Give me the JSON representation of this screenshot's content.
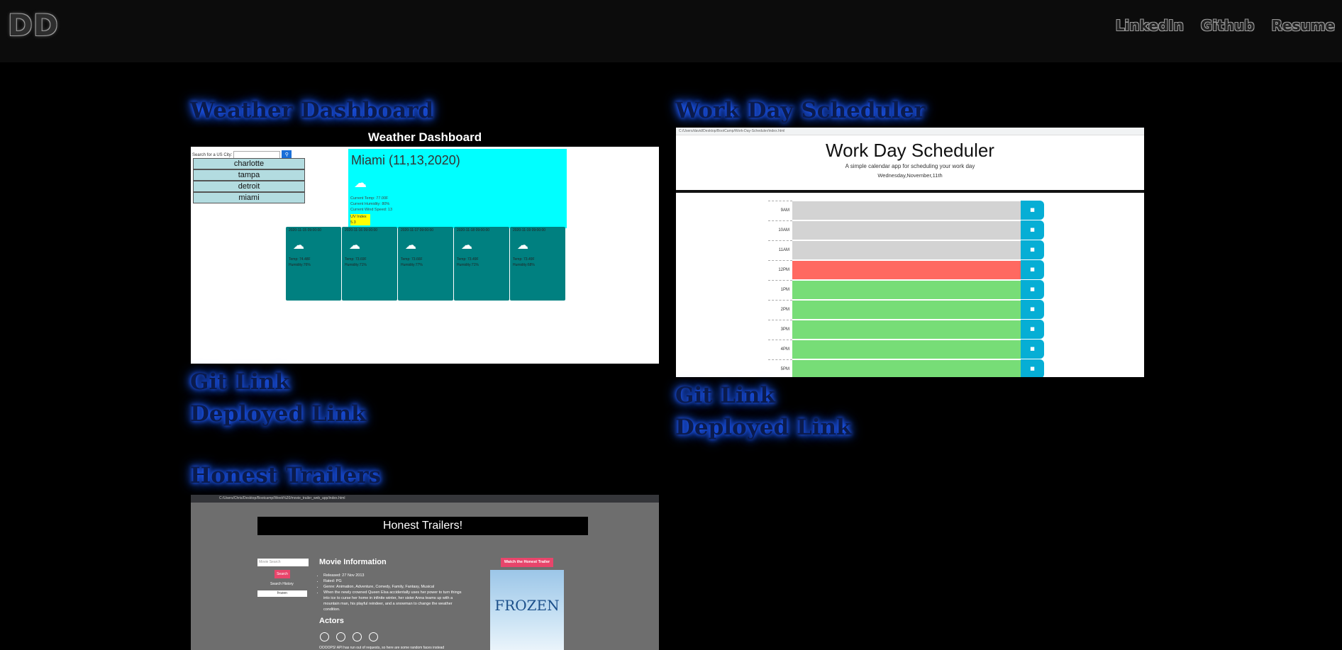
{
  "header": {
    "logo": "DD",
    "nav": [
      "LinkedIn",
      "Github",
      "Resume"
    ]
  },
  "projects": [
    {
      "title": "Weather Dashboard",
      "git": "Git Link",
      "deployed": "Deployed Link"
    },
    {
      "title": "Work Day Scheduler",
      "git": "Git Link",
      "deployed": "Deployed Link"
    },
    {
      "title": "Honest Trailers"
    }
  ],
  "weather_shot": {
    "heading": "Weather Dashboard",
    "search_label": "Search for a US City:",
    "search_icon": "search-icon",
    "cities": [
      "charlotte",
      "tampa",
      "detroit",
      "miami"
    ],
    "city_now": "Miami (11,13,2020)",
    "weather_icon": "cloud-icon",
    "info": [
      "Current Temp: 77.00F",
      "Current Humidity: 80%",
      "Current Wind Speed: 13"
    ],
    "uv_label": "UV Index",
    "uv_value": "5.3",
    "forecast": [
      {
        "date": "2020-11-15 09:00:00",
        "temp": "Temp: 74.48F",
        "humidity": "Humidity:76%"
      },
      {
        "date": "2020-11-16 09:00:00",
        "temp": "Temp: 73.69F",
        "humidity": "Humidity:71%"
      },
      {
        "date": "2020-11-17 09:00:00",
        "temp": "Temp: 73.66F",
        "humidity": "Humidity:77%"
      },
      {
        "date": "2020-11-18 09:00:00",
        "temp": "Temp: 73.49F",
        "humidity": "Humidity:71%"
      },
      {
        "date": "2020-11-19 09:00:00",
        "temp": "Temp: 73.49F",
        "humidity": "Humidity:68%"
      }
    ]
  },
  "scheduler_shot": {
    "address": "C:/Users/david/Desktop/BootCamp/Work-Day-Scheduler/index.html",
    "title": "Work Day Scheduler",
    "subtitle": "A simple calendar app for scheduling your work day",
    "date": "Wednesday,November,11th",
    "hours": [
      "9AM",
      "10AM",
      "11AM",
      "12PM",
      "1PM",
      "2PM",
      "3PM",
      "4PM",
      "5PM"
    ],
    "save_icon": "save-icon",
    "colors": {
      "past": "#d3d3d3",
      "present": "#ff6961",
      "future": "#77dd77",
      "save": "#06aed5"
    }
  },
  "trailers_shot": {
    "address": "C:/Users/Chris/Desktop/Bootcamp/Week%20/movie_trailer_web_app/index.html",
    "heading": "Honest Trailers!",
    "search_placeholder": "Movie Search",
    "search_button": "Search",
    "history_label": "Search History",
    "history_item": "frozen",
    "movie_info_heading": "Movie Information",
    "info": [
      "Released: 27 Nov 2013",
      "Rated: PG",
      "Genre: Animation, Adventure, Comedy, Family, Fantasy, Musical",
      "When the newly crowned Queen Elsa accidentally uses her power to turn things into ice to curse her home in infinite winter, her sister Anna teams up with a mountain man, his playful reindeer, and a snowman to change the weather condition."
    ],
    "actors_heading": "Actors",
    "watch_button": "Watch the Honest Trailer",
    "poster_title": "FROZEN",
    "note": "OOOOPS! API has run out of requests, so here are some random faces instead"
  }
}
